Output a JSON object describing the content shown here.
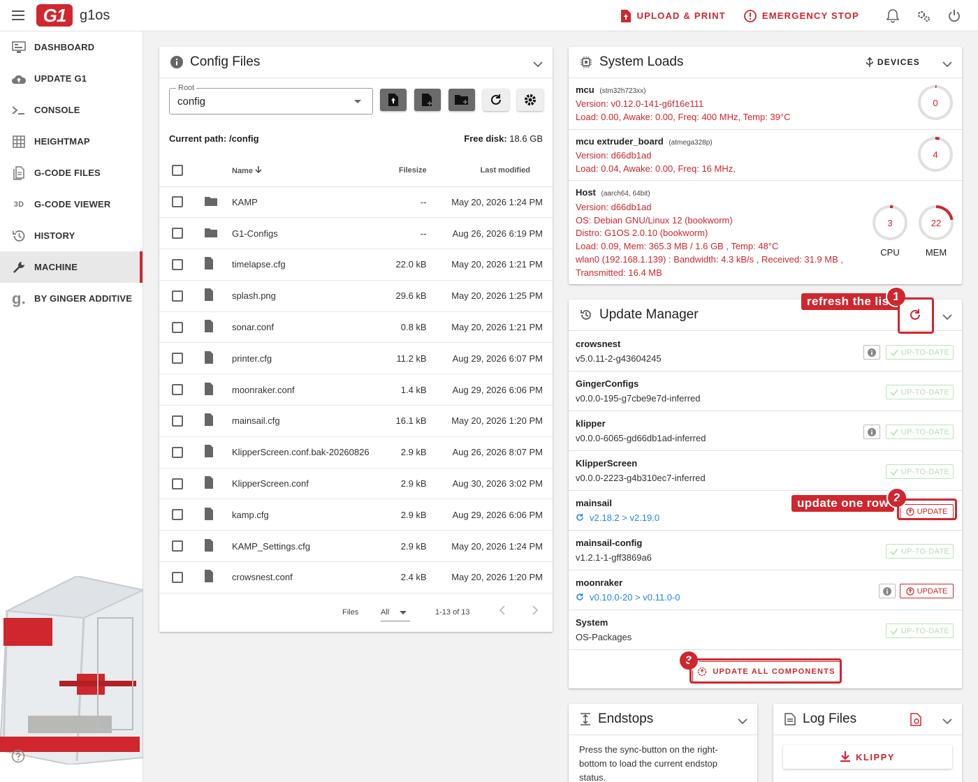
{
  "topbar": {
    "brand_logo": "G1",
    "brand_name": "g1os",
    "upload_print": "UPLOAD & PRINT",
    "emergency_stop": "EMERGENCY STOP"
  },
  "sidebar": {
    "items": [
      {
        "label": "DASHBOARD",
        "icon": "monitor-icon"
      },
      {
        "label": "UPDATE G1",
        "icon": "cloud-upload-icon"
      },
      {
        "label": "CONSOLE",
        "icon": "console-icon"
      },
      {
        "label": "HEIGHTMAP",
        "icon": "grid-icon"
      },
      {
        "label": "G-CODE FILES",
        "icon": "file-icon"
      },
      {
        "label": "G-CODE VIEWER",
        "icon": "3d-icon"
      },
      {
        "label": "HISTORY",
        "icon": "history-icon"
      },
      {
        "label": "MACHINE",
        "icon": "wrench-icon"
      },
      {
        "label": "BY GINGER ADDITIVE",
        "icon": "ginger-icon"
      }
    ],
    "active": "MACHINE"
  },
  "config": {
    "title": "Config Files",
    "root_label": "Root",
    "root_value": "config",
    "current_path_label": "Current path:",
    "current_path": "/config",
    "free_disk_label": "Free disk:",
    "free_disk": "18.6 GB",
    "columns": {
      "name": "Name",
      "filesize": "Filesize",
      "modified": "Last modified"
    },
    "files": [
      {
        "name": "KAMP",
        "size": "--",
        "modified": "May 20, 2026 1:24 PM",
        "type": "folder"
      },
      {
        "name": "G1-Configs",
        "size": "--",
        "modified": "Aug 26, 2026 6:19 PM",
        "type": "folder"
      },
      {
        "name": "timelapse.cfg",
        "size": "22.0 kB",
        "modified": "May 20, 2026 1:21 PM",
        "type": "file"
      },
      {
        "name": "splash.png",
        "size": "29.6 kB",
        "modified": "May 20, 2026 1:25 PM",
        "type": "file"
      },
      {
        "name": "sonar.conf",
        "size": "0.8 kB",
        "modified": "May 20, 2026 1:21 PM",
        "type": "file"
      },
      {
        "name": "printer.cfg",
        "size": "11.2 kB",
        "modified": "Aug 29, 2026 6:07 PM",
        "type": "file"
      },
      {
        "name": "moonraker.conf",
        "size": "1.4 kB",
        "modified": "Aug 29, 2026 6:06 PM",
        "type": "file"
      },
      {
        "name": "mainsail.cfg",
        "size": "16.1 kB",
        "modified": "May 20, 2026 1:20 PM",
        "type": "file"
      },
      {
        "name": "KlipperScreen.conf.bak-20260826",
        "size": "2.9 kB",
        "modified": "Aug 26, 2026 8:07 PM",
        "type": "file"
      },
      {
        "name": "KlipperScreen.conf",
        "size": "2.9 kB",
        "modified": "Aug 30, 2026 3:02 PM",
        "type": "file"
      },
      {
        "name": "kamp.cfg",
        "size": "2.9 kB",
        "modified": "Aug 29, 2026 6:06 PM",
        "type": "file"
      },
      {
        "name": "KAMP_Settings.cfg",
        "size": "2.9 kB",
        "modified": "May 20, 2026 1:24 PM",
        "type": "file"
      },
      {
        "name": "crowsnest.conf",
        "size": "2.4 kB",
        "modified": "May 20, 2026 1:20 PM",
        "type": "file"
      }
    ],
    "footer": {
      "files_label": "Files",
      "per_page": "All",
      "range": "1-13 of 13"
    }
  },
  "system_loads": {
    "title": "System Loads",
    "devices_label": "DEVICES",
    "mcu": {
      "name": "mcu",
      "chip": "(stm32h723xx)",
      "version": "Version: v0.12.0-141-g6f16e111",
      "load": "Load: 0.00, Awake: 0.00, Freq: 400 MHz, Temp: 39°C",
      "gauge": "0",
      "gauge_value": 0
    },
    "extruder": {
      "name": "mcu extruder_board",
      "chip": "(atmega328p)",
      "version": "Version: d66db1ad",
      "load": "Load: 0.04, Awake: 0.00, Freq: 16 MHz,",
      "gauge": "4",
      "gauge_value": 4
    },
    "host": {
      "name": "Host",
      "arch": "(aarch64, 64bit)",
      "lines": [
        "Version: d66db1ad",
        "OS: Debian GNU/Linux 12 (bookworm)",
        "Distro: G1OS 2.0.10 (bookworm)",
        "Load: 0.09, Mem: 365.3 MB / 1.6 GB , Temp: 48°C",
        "wlan0 (192.168.1.139) : Bandwidth: 4.3 kB/s , Received: 31.9 MB ,",
        "Transmitted: 16.4 MB"
      ],
      "cpu": "3",
      "cpu_value": 3,
      "cpu_label": "CPU",
      "mem": "22",
      "mem_value": 22,
      "mem_label": "MEM"
    }
  },
  "update_manager": {
    "title": "Update Manager",
    "uptodate_label": "UP-TO-DATE",
    "update_label": "UPDATE",
    "update_all_label": "UPDATE ALL COMPONENTS",
    "rows": [
      {
        "name": "crowsnest",
        "version": "v5.0.11-2-g43604245",
        "status": "up",
        "info": true
      },
      {
        "name": "GingerConfigs",
        "version": "v0.0.0-195-g7cbe9e7d-inferred",
        "status": "up",
        "info": false
      },
      {
        "name": "klipper",
        "version": "v0.0.0-6065-gd66db1ad-inferred",
        "status": "up",
        "info": true
      },
      {
        "name": "KlipperScreen",
        "version": "v0.0.0-2223-g4b310ec7-inferred",
        "status": "up",
        "info": false
      },
      {
        "name": "mainsail",
        "version": "v2.18.2 > v2.19.0",
        "status": "update",
        "info": false
      },
      {
        "name": "mainsail-config",
        "version": "v1.2.1-1-gff3869a6",
        "status": "up",
        "info": false
      },
      {
        "name": "moonraker",
        "version": "v0.10.0-20 > v0.11.0-0",
        "status": "update",
        "info": true
      },
      {
        "name": "System",
        "version": "OS-Packages",
        "status": "up",
        "info": false
      }
    ]
  },
  "annotations": {
    "a1_text": "refresh the list",
    "a1_num": "1",
    "a2_text": "update one row",
    "a2_num": "2",
    "a3_num": "3"
  },
  "endstops": {
    "title": "Endstops",
    "text": "Press the sync-button on the right-bottom to load the current endstop status."
  },
  "logfiles": {
    "title": "Log Files",
    "klippy_label": "KLIPPY"
  },
  "colors": {
    "accent": "#d0262d",
    "link": "#1e88e5"
  }
}
